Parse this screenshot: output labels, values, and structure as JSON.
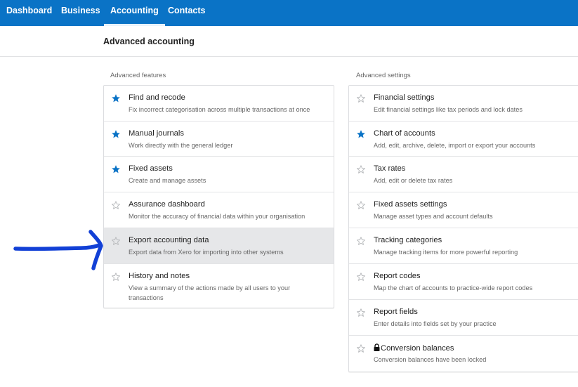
{
  "nav": {
    "tabs": [
      {
        "label": "Dashboard",
        "active": false
      },
      {
        "label": "Business",
        "active": false
      },
      {
        "label": "Accounting",
        "active": true
      },
      {
        "label": "Contacts",
        "active": false
      }
    ],
    "bg_color": "#0a73c6"
  },
  "page": {
    "title": "Advanced accounting"
  },
  "features": {
    "label": "Advanced features",
    "items": [
      {
        "title": "Find and recode",
        "desc": "Fix incorrect categorisation across multiple transactions at once",
        "starred": true,
        "icon": "star-filled-icon"
      },
      {
        "title": "Manual journals",
        "desc": "Work directly with the general ledger",
        "starred": true,
        "icon": "star-filled-icon"
      },
      {
        "title": "Fixed assets",
        "desc": "Create and manage assets",
        "starred": true,
        "icon": "star-filled-icon"
      },
      {
        "title": "Assurance dashboard",
        "desc": "Monitor the accuracy of financial data within your organisation",
        "starred": false,
        "icon": "star-outline-icon"
      },
      {
        "title": "Export accounting data",
        "desc": "Export data from Xero for importing into other systems",
        "starred": false,
        "icon": "star-outline-icon",
        "highlighted": true
      },
      {
        "title": "History and notes",
        "desc": "View a summary of the actions made by all users to your transactions",
        "starred": false,
        "icon": "star-outline-icon"
      }
    ]
  },
  "settings": {
    "label": "Advanced settings",
    "items": [
      {
        "title": "Financial settings",
        "desc": "Edit financial settings like tax periods and lock dates",
        "starred": false,
        "icon": "star-outline-icon"
      },
      {
        "title": "Chart of accounts",
        "desc": "Add, edit, archive, delete, import or export your accounts",
        "starred": true,
        "icon": "star-filled-icon"
      },
      {
        "title": "Tax rates",
        "desc": "Add, edit or delete tax rates",
        "starred": false,
        "icon": "star-outline-icon"
      },
      {
        "title": "Fixed assets settings",
        "desc": "Manage asset types and account defaults",
        "starred": false,
        "icon": "star-outline-icon"
      },
      {
        "title": "Tracking categories",
        "desc": "Manage tracking items for more powerful reporting",
        "starred": false,
        "icon": "star-outline-icon"
      },
      {
        "title": "Report codes",
        "desc": "Map the chart of accounts to practice-wide report codes",
        "starred": false,
        "icon": "star-outline-icon"
      },
      {
        "title": "Report fields",
        "desc": "Enter details into fields set by your practice",
        "starred": false,
        "icon": "star-outline-icon"
      },
      {
        "title": "Conversion balances",
        "desc": "Conversion balances have been locked",
        "starred": false,
        "icon": "star-outline-icon",
        "locked": true
      }
    ]
  },
  "colors": {
    "star_filled": "#0a73c6",
    "star_outline": "#b5b7ba",
    "annotation_arrow": "#1240d6"
  }
}
